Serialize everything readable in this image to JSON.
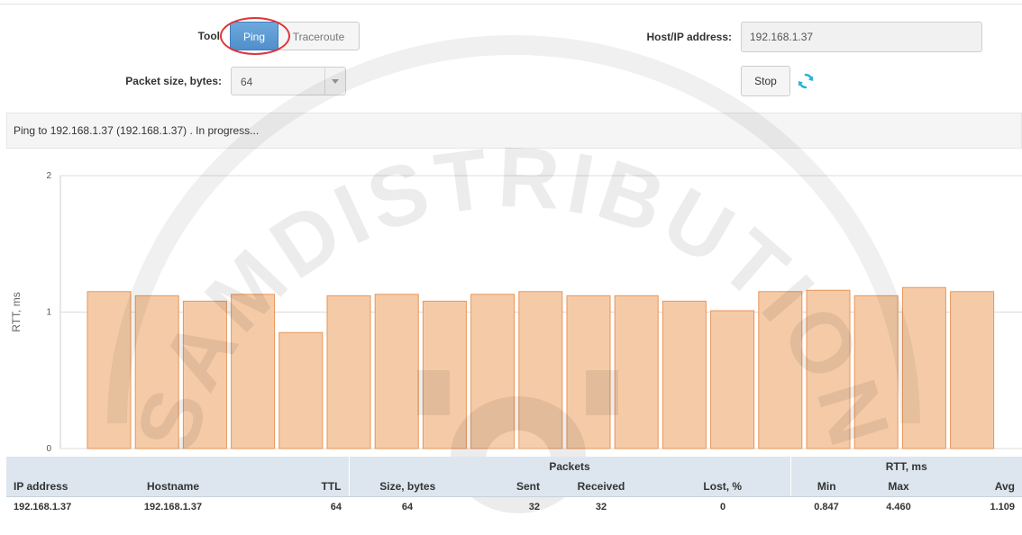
{
  "form": {
    "tool_label": "Tool",
    "tool_options": [
      "Ping",
      "Traceroute"
    ],
    "tool_selected": "Ping",
    "packet_size_label": "Packet size, bytes:",
    "packet_size_value": "64",
    "host_label": "Host/IP address:",
    "host_value": "192.168.1.37",
    "stop_label": "Stop",
    "refresh_icon": "refresh-icon"
  },
  "status": {
    "text": "Ping to 192.168.1.37 (192.168.1.37) . In progress..."
  },
  "chart_data": {
    "type": "bar",
    "ylabel": "RTT, ms",
    "ylim": [
      0,
      2
    ],
    "yticks": [
      "0",
      "1",
      "2"
    ],
    "grid": true,
    "values": [
      1.15,
      1.12,
      1.08,
      1.13,
      0.85,
      1.12,
      1.13,
      1.08,
      1.13,
      1.15,
      1.12,
      1.12,
      1.08,
      1.01,
      1.15,
      1.16,
      1.12,
      1.18,
      1.15
    ],
    "bar_color": "#f5cba7",
    "bar_stroke": "#e8955a"
  },
  "table": {
    "group_headers": {
      "packets": "Packets",
      "rtt": "RTT, ms"
    },
    "columns": [
      "IP address",
      "Hostname",
      "TTL",
      "Size, bytes",
      "Sent",
      "Received",
      "Lost, %",
      "Min",
      "Max",
      "Avg"
    ],
    "rows": [
      [
        "192.168.1.37",
        "192.168.1.37",
        "64",
        "64",
        "32",
        "32",
        "0",
        "0.847",
        "4.460",
        "1.109"
      ]
    ]
  },
  "watermark": {
    "text": "SAMDISTRIBUTION"
  },
  "colors": {
    "accent": "#5b9bd5",
    "highlight_ring": "#e0343a",
    "refresh": "#2bb3d9",
    "table_header": "#dde6ee"
  }
}
